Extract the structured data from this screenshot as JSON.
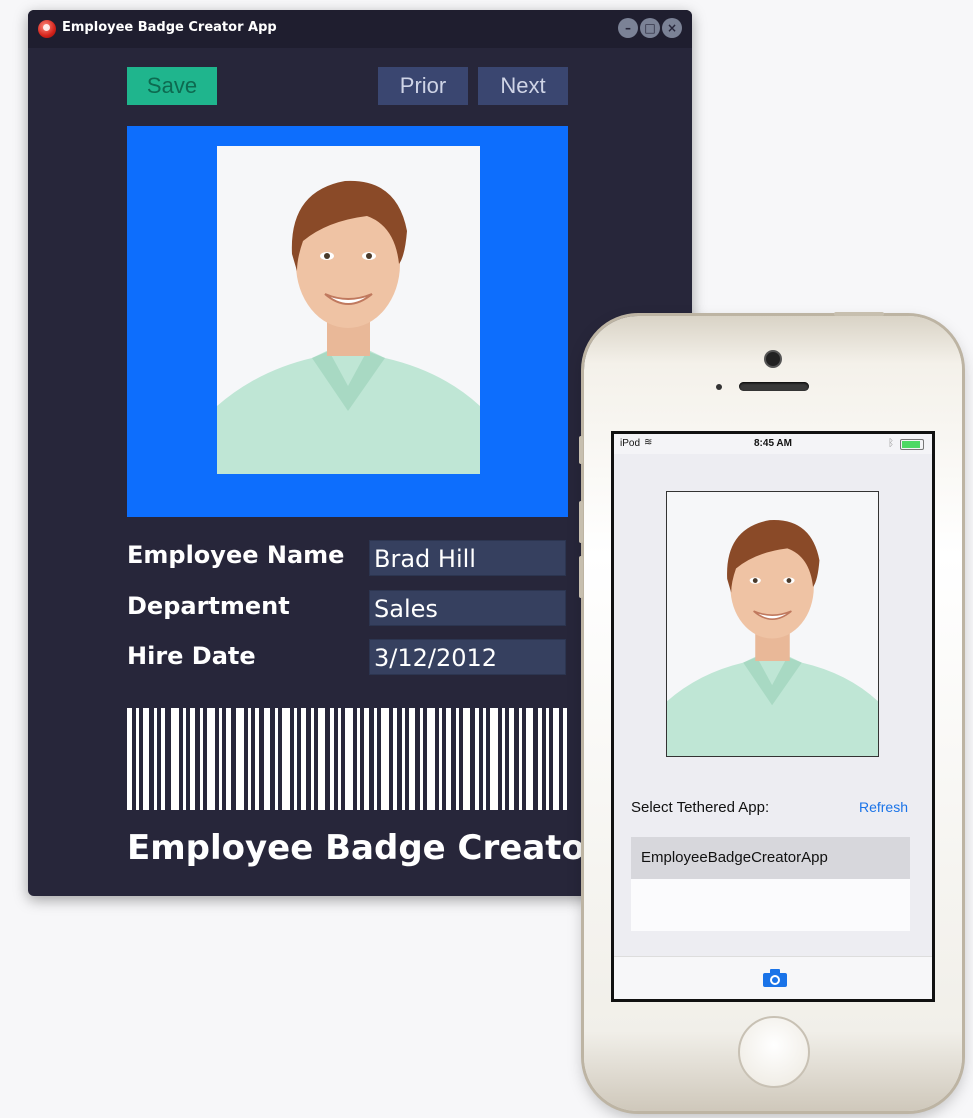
{
  "window": {
    "title": "Employee Badge Creator App",
    "controls": [
      "minimize",
      "maximize",
      "close"
    ]
  },
  "toolbar": {
    "save_label": "Save",
    "prior_label": "Prior",
    "next_label": "Next"
  },
  "form": {
    "name_label": "Employee Name",
    "name_value": "Brad Hill",
    "department_label": "Department",
    "department_value": "Sales",
    "hire_date_label": "Hire Date",
    "hire_date_value": "3/12/2012"
  },
  "badge": {
    "title": "Employee Badge Creator"
  },
  "colors": {
    "window_bg": "#27263a",
    "save_button": "#1fb58d",
    "nav_button": "#3a4670",
    "photo_panel": "#0d6efd",
    "input_bg": "#36405f",
    "link_blue": "#1a73e8"
  },
  "phone": {
    "status": {
      "carrier": "iPod",
      "time": "8:45 AM"
    },
    "select_label": "Select Tethered App:",
    "refresh_label": "Refresh",
    "apps": [
      "EmployeeBadgeCreatorApp"
    ],
    "toolbar_icon": "camera-icon"
  }
}
